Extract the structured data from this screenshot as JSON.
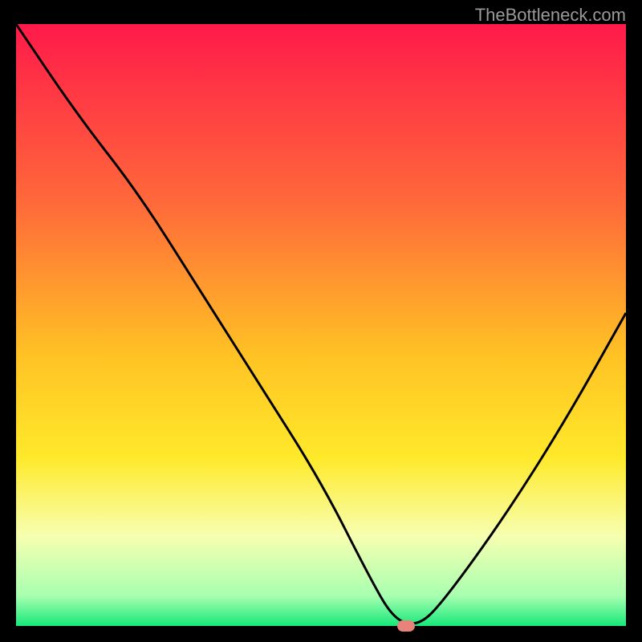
{
  "watermark": "TheBottleneck.com",
  "chart_data": {
    "type": "line",
    "title": "",
    "xlabel": "",
    "ylabel": "",
    "x_range": [
      0,
      100
    ],
    "y_range": [
      0,
      100
    ],
    "series": [
      {
        "name": "bottleneck-curve",
        "x": [
          0,
          10,
          20,
          30,
          40,
          50,
          58,
          62,
          66,
          70,
          80,
          90,
          100
        ],
        "values": [
          100,
          85,
          72,
          56,
          40,
          24,
          8,
          1,
          0,
          4,
          18,
          34,
          52
        ]
      }
    ],
    "marker": {
      "x": 64,
      "y": 0
    },
    "gradient_stops": [
      {
        "pos": 0.0,
        "color": "#ff1a4a"
      },
      {
        "pos": 0.3,
        "color": "#ff6a3a"
      },
      {
        "pos": 0.55,
        "color": "#ffc224"
      },
      {
        "pos": 0.72,
        "color": "#ffe92a"
      },
      {
        "pos": 0.85,
        "color": "#f7ffb0"
      },
      {
        "pos": 0.95,
        "color": "#a8ffb0"
      },
      {
        "pos": 1.0,
        "color": "#17e87a"
      }
    ]
  }
}
